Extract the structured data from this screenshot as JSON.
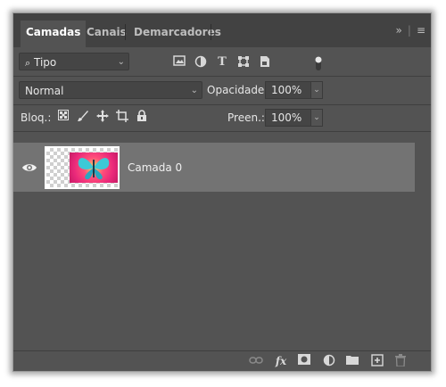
{
  "tabs": [
    {
      "label": "Camadas",
      "active": true
    },
    {
      "label": "Canais",
      "active": false
    },
    {
      "label": "Demarcadores",
      "active": false
    }
  ],
  "tab_icons": {
    "expand": "»",
    "menu": "≡"
  },
  "filter": {
    "kind_label": "Tipo",
    "icons": [
      "image-filter-icon",
      "adjustment-filter-icon",
      "type-filter-icon",
      "shape-filter-icon",
      "smart-object-filter-icon",
      "filter-toggle-icon"
    ]
  },
  "blend": {
    "mode": "Normal",
    "opacity_label": "Opacidade:",
    "opacity_value": "100%"
  },
  "lock": {
    "label": "Bloq.:",
    "fill_label": "Preen.:",
    "fill_value": "100%"
  },
  "layers": [
    {
      "name": "Camada 0",
      "visible": true,
      "selected": true
    }
  ],
  "colors": {
    "panel": "#535353",
    "tabbar": "#424242",
    "selected_layer": "#737373",
    "text": "#e6e6e6"
  }
}
